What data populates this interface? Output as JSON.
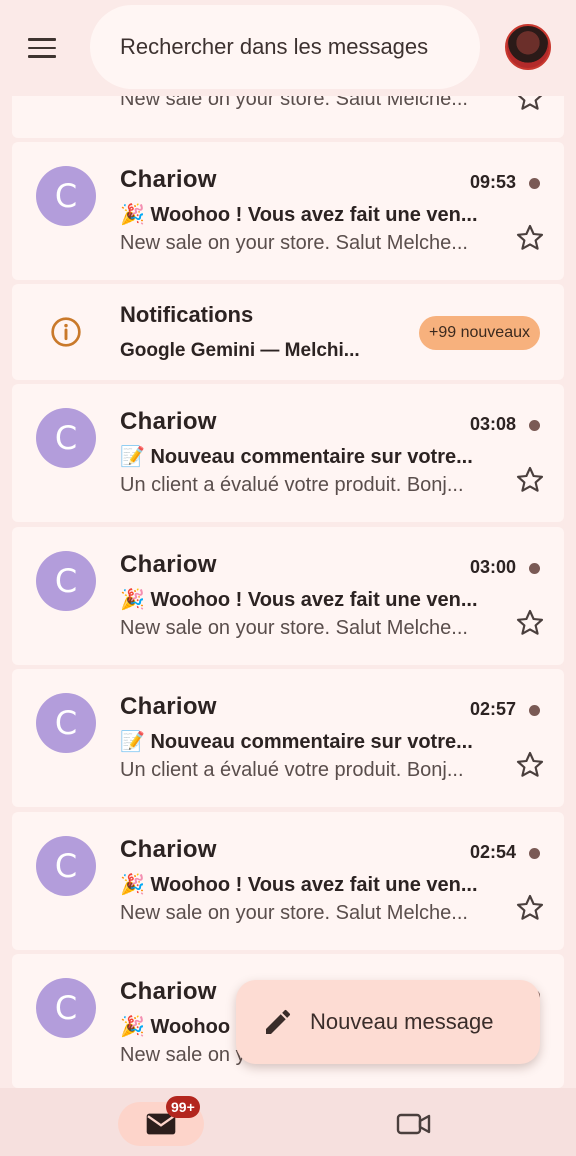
{
  "header": {
    "search_placeholder": "Rechercher dans les messages"
  },
  "emails": [
    {
      "sender": "",
      "time": "",
      "subject": "",
      "preview": "New sale on your store. Salut Melche..."
    },
    {
      "avatar_letter": "C",
      "sender": "Chariow",
      "time": "09:53",
      "subject_emoji": "🎉",
      "subject": "Woohoo ! Vous avez fait une ven...",
      "preview": "New sale on your store. Salut Melche..."
    },
    {
      "avatar_letter": "C",
      "sender": "Chariow",
      "time": "03:08",
      "subject_emoji": "📝",
      "subject": "Nouveau commentaire sur votre...",
      "preview": "Un client a évalué votre produit. Bonj..."
    },
    {
      "avatar_letter": "C",
      "sender": "Chariow",
      "time": "03:00",
      "subject_emoji": "🎉",
      "subject": "Woohoo ! Vous avez fait une ven...",
      "preview": "New sale on your store. Salut Melche..."
    },
    {
      "avatar_letter": "C",
      "sender": "Chariow",
      "time": "02:57",
      "subject_emoji": "📝",
      "subject": "Nouveau commentaire sur votre...",
      "preview": "Un client a évalué votre produit. Bonj..."
    },
    {
      "avatar_letter": "C",
      "sender": "Chariow",
      "time": "02:54",
      "subject_emoji": "🎉",
      "subject": "Woohoo ! Vous avez fait une ven...",
      "preview": "New sale on your store. Salut Melche..."
    },
    {
      "avatar_letter": "C",
      "sender": "Chariow",
      "time": "",
      "subject_emoji": "🎉",
      "subject": "Woohoo",
      "preview": "New sale on y"
    }
  ],
  "notifications": {
    "title": "Notifications",
    "subtitle": "Google Gemini — Melchi...",
    "badge": "+99 nouveaux"
  },
  "fab": {
    "label": "Nouveau message"
  },
  "bottom_nav": {
    "mail_badge": "99+"
  },
  "colors": {
    "avatar_bg": "#b39ddb",
    "badge_orange": "#f7b17d",
    "badge_red": "#b3261e"
  }
}
